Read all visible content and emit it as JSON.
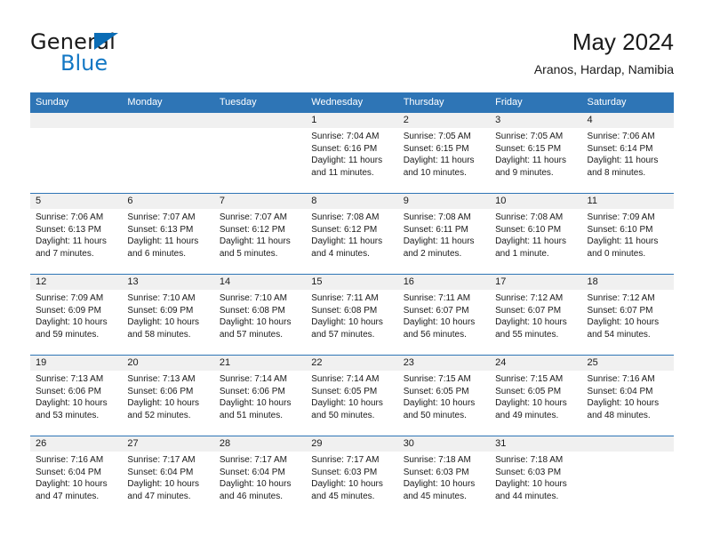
{
  "brand": {
    "name_part1": "General",
    "name_part2": "Blue",
    "triangle_icon": "blue-triangle-logo-mark",
    "accent_color": "#1277c4"
  },
  "header": {
    "title": "May 2024",
    "subtitle": "Aranos, Hardap, Namibia"
  },
  "theme": {
    "header_blue": "#2e75b6",
    "daynum_band": "#f0f0f0",
    "cell_bg": "#ffffff",
    "text": "#1a1a1a"
  },
  "weekdays": [
    "Sunday",
    "Monday",
    "Tuesday",
    "Wednesday",
    "Thursday",
    "Friday",
    "Saturday"
  ],
  "weeks": [
    [
      {
        "day": "",
        "sunrise": "",
        "sunset": "",
        "daylight1": "",
        "daylight2": ""
      },
      {
        "day": "",
        "sunrise": "",
        "sunset": "",
        "daylight1": "",
        "daylight2": ""
      },
      {
        "day": "",
        "sunrise": "",
        "sunset": "",
        "daylight1": "",
        "daylight2": ""
      },
      {
        "day": "1",
        "sunrise": "Sunrise: 7:04 AM",
        "sunset": "Sunset: 6:16 PM",
        "daylight1": "Daylight: 11 hours",
        "daylight2": "and 11 minutes."
      },
      {
        "day": "2",
        "sunrise": "Sunrise: 7:05 AM",
        "sunset": "Sunset: 6:15 PM",
        "daylight1": "Daylight: 11 hours",
        "daylight2": "and 10 minutes."
      },
      {
        "day": "3",
        "sunrise": "Sunrise: 7:05 AM",
        "sunset": "Sunset: 6:15 PM",
        "daylight1": "Daylight: 11 hours",
        "daylight2": "and 9 minutes."
      },
      {
        "day": "4",
        "sunrise": "Sunrise: 7:06 AM",
        "sunset": "Sunset: 6:14 PM",
        "daylight1": "Daylight: 11 hours",
        "daylight2": "and 8 minutes."
      }
    ],
    [
      {
        "day": "5",
        "sunrise": "Sunrise: 7:06 AM",
        "sunset": "Sunset: 6:13 PM",
        "daylight1": "Daylight: 11 hours",
        "daylight2": "and 7 minutes."
      },
      {
        "day": "6",
        "sunrise": "Sunrise: 7:07 AM",
        "sunset": "Sunset: 6:13 PM",
        "daylight1": "Daylight: 11 hours",
        "daylight2": "and 6 minutes."
      },
      {
        "day": "7",
        "sunrise": "Sunrise: 7:07 AM",
        "sunset": "Sunset: 6:12 PM",
        "daylight1": "Daylight: 11 hours",
        "daylight2": "and 5 minutes."
      },
      {
        "day": "8",
        "sunrise": "Sunrise: 7:08 AM",
        "sunset": "Sunset: 6:12 PM",
        "daylight1": "Daylight: 11 hours",
        "daylight2": "and 4 minutes."
      },
      {
        "day": "9",
        "sunrise": "Sunrise: 7:08 AM",
        "sunset": "Sunset: 6:11 PM",
        "daylight1": "Daylight: 11 hours",
        "daylight2": "and 2 minutes."
      },
      {
        "day": "10",
        "sunrise": "Sunrise: 7:08 AM",
        "sunset": "Sunset: 6:10 PM",
        "daylight1": "Daylight: 11 hours",
        "daylight2": "and 1 minute."
      },
      {
        "day": "11",
        "sunrise": "Sunrise: 7:09 AM",
        "sunset": "Sunset: 6:10 PM",
        "daylight1": "Daylight: 11 hours",
        "daylight2": "and 0 minutes."
      }
    ],
    [
      {
        "day": "12",
        "sunrise": "Sunrise: 7:09 AM",
        "sunset": "Sunset: 6:09 PM",
        "daylight1": "Daylight: 10 hours",
        "daylight2": "and 59 minutes."
      },
      {
        "day": "13",
        "sunrise": "Sunrise: 7:10 AM",
        "sunset": "Sunset: 6:09 PM",
        "daylight1": "Daylight: 10 hours",
        "daylight2": "and 58 minutes."
      },
      {
        "day": "14",
        "sunrise": "Sunrise: 7:10 AM",
        "sunset": "Sunset: 6:08 PM",
        "daylight1": "Daylight: 10 hours",
        "daylight2": "and 57 minutes."
      },
      {
        "day": "15",
        "sunrise": "Sunrise: 7:11 AM",
        "sunset": "Sunset: 6:08 PM",
        "daylight1": "Daylight: 10 hours",
        "daylight2": "and 57 minutes."
      },
      {
        "day": "16",
        "sunrise": "Sunrise: 7:11 AM",
        "sunset": "Sunset: 6:07 PM",
        "daylight1": "Daylight: 10 hours",
        "daylight2": "and 56 minutes."
      },
      {
        "day": "17",
        "sunrise": "Sunrise: 7:12 AM",
        "sunset": "Sunset: 6:07 PM",
        "daylight1": "Daylight: 10 hours",
        "daylight2": "and 55 minutes."
      },
      {
        "day": "18",
        "sunrise": "Sunrise: 7:12 AM",
        "sunset": "Sunset: 6:07 PM",
        "daylight1": "Daylight: 10 hours",
        "daylight2": "and 54 minutes."
      }
    ],
    [
      {
        "day": "19",
        "sunrise": "Sunrise: 7:13 AM",
        "sunset": "Sunset: 6:06 PM",
        "daylight1": "Daylight: 10 hours",
        "daylight2": "and 53 minutes."
      },
      {
        "day": "20",
        "sunrise": "Sunrise: 7:13 AM",
        "sunset": "Sunset: 6:06 PM",
        "daylight1": "Daylight: 10 hours",
        "daylight2": "and 52 minutes."
      },
      {
        "day": "21",
        "sunrise": "Sunrise: 7:14 AM",
        "sunset": "Sunset: 6:06 PM",
        "daylight1": "Daylight: 10 hours",
        "daylight2": "and 51 minutes."
      },
      {
        "day": "22",
        "sunrise": "Sunrise: 7:14 AM",
        "sunset": "Sunset: 6:05 PM",
        "daylight1": "Daylight: 10 hours",
        "daylight2": "and 50 minutes."
      },
      {
        "day": "23",
        "sunrise": "Sunrise: 7:15 AM",
        "sunset": "Sunset: 6:05 PM",
        "daylight1": "Daylight: 10 hours",
        "daylight2": "and 50 minutes."
      },
      {
        "day": "24",
        "sunrise": "Sunrise: 7:15 AM",
        "sunset": "Sunset: 6:05 PM",
        "daylight1": "Daylight: 10 hours",
        "daylight2": "and 49 minutes."
      },
      {
        "day": "25",
        "sunrise": "Sunrise: 7:16 AM",
        "sunset": "Sunset: 6:04 PM",
        "daylight1": "Daylight: 10 hours",
        "daylight2": "and 48 minutes."
      }
    ],
    [
      {
        "day": "26",
        "sunrise": "Sunrise: 7:16 AM",
        "sunset": "Sunset: 6:04 PM",
        "daylight1": "Daylight: 10 hours",
        "daylight2": "and 47 minutes."
      },
      {
        "day": "27",
        "sunrise": "Sunrise: 7:17 AM",
        "sunset": "Sunset: 6:04 PM",
        "daylight1": "Daylight: 10 hours",
        "daylight2": "and 47 minutes."
      },
      {
        "day": "28",
        "sunrise": "Sunrise: 7:17 AM",
        "sunset": "Sunset: 6:04 PM",
        "daylight1": "Daylight: 10 hours",
        "daylight2": "and 46 minutes."
      },
      {
        "day": "29",
        "sunrise": "Sunrise: 7:17 AM",
        "sunset": "Sunset: 6:03 PM",
        "daylight1": "Daylight: 10 hours",
        "daylight2": "and 45 minutes."
      },
      {
        "day": "30",
        "sunrise": "Sunrise: 7:18 AM",
        "sunset": "Sunset: 6:03 PM",
        "daylight1": "Daylight: 10 hours",
        "daylight2": "and 45 minutes."
      },
      {
        "day": "31",
        "sunrise": "Sunrise: 7:18 AM",
        "sunset": "Sunset: 6:03 PM",
        "daylight1": "Daylight: 10 hours",
        "daylight2": "and 44 minutes."
      },
      {
        "day": "",
        "sunrise": "",
        "sunset": "",
        "daylight1": "",
        "daylight2": ""
      }
    ]
  ]
}
